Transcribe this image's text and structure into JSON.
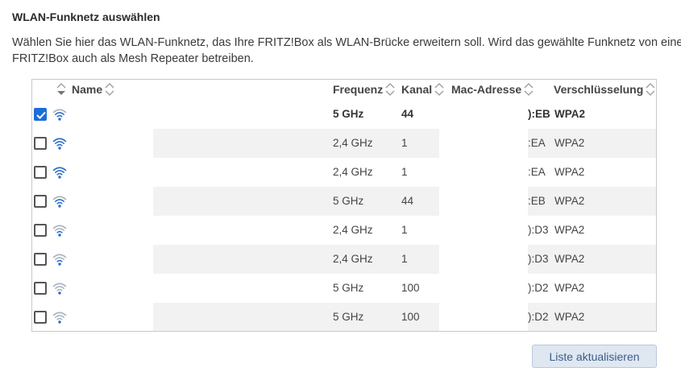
{
  "section": {
    "heading": "WLAN-Funknetz auswählen",
    "description_line1": "Wählen Sie hier das WLAN-Funknetz, das Ihre FRITZ!Box als WLAN-Brücke erweitern soll. Wird das gewählte Funknetz von eine",
    "description_line2": "FRITZ!Box auch als Mesh Repeater betreiben."
  },
  "table": {
    "columns": {
      "name": "Name",
      "frequency": "Frequenz",
      "channel": "Kanal",
      "mac": "Mac-Adresse",
      "encryption": "Verschlüsselung"
    },
    "rows": [
      {
        "checked": true,
        "signal": 3,
        "frequency": "5 GHz",
        "channel": "44",
        "mac": "):EB",
        "encryption": "WPA2",
        "selected": true
      },
      {
        "checked": false,
        "signal": 4,
        "frequency": "2,4 GHz",
        "channel": "1",
        "mac": ":EA",
        "encryption": "WPA2",
        "selected": false
      },
      {
        "checked": false,
        "signal": 4,
        "frequency": "2,4 GHz",
        "channel": "1",
        "mac": ":EA",
        "encryption": "WPA2",
        "selected": false
      },
      {
        "checked": false,
        "signal": 3,
        "frequency": "5 GHz",
        "channel": "44",
        "mac": ":EB",
        "encryption": "WPA2",
        "selected": false
      },
      {
        "checked": false,
        "signal": 2,
        "frequency": "2,4 GHz",
        "channel": "1",
        "mac": "):D3",
        "encryption": "WPA2",
        "selected": false
      },
      {
        "checked": false,
        "signal": 2,
        "frequency": "2,4 GHz",
        "channel": "1",
        "mac": "):D3",
        "encryption": "WPA2",
        "selected": false
      },
      {
        "checked": false,
        "signal": 1,
        "frequency": "5 GHz",
        "channel": "100",
        "mac": "):D2",
        "encryption": "WPA2",
        "selected": false
      },
      {
        "checked": false,
        "signal": 1,
        "frequency": "5 GHz",
        "channel": "100",
        "mac": "):D2",
        "encryption": "WPA2",
        "selected": false
      }
    ]
  },
  "actions": {
    "refresh_label": "Liste aktualisieren"
  },
  "colors": {
    "accent": "#1c6ed8",
    "wifi_strong": "#2a6fc9",
    "wifi_weak": "#a9b4c2",
    "stripe": "#f2f2f2"
  },
  "icons": {
    "checkbox_checked": "checkmark-icon",
    "signal": "wifi-signal-icon",
    "sort": "sort-arrows-icon"
  }
}
